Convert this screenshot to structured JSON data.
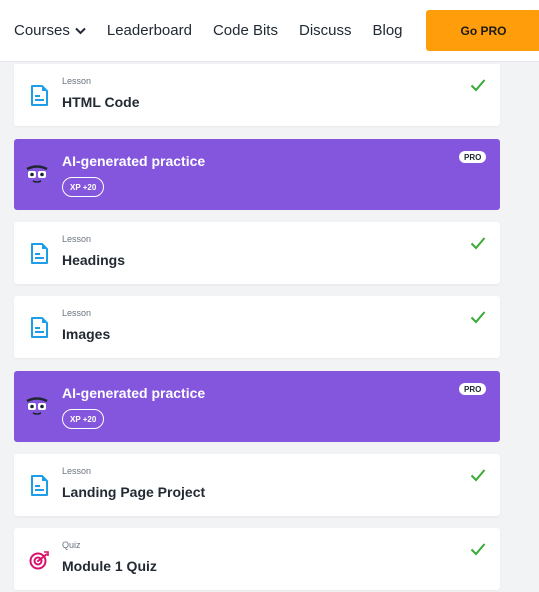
{
  "nav": {
    "courses": "Courses",
    "leaderboard": "Leaderboard",
    "code_bits": "Code Bits",
    "discuss": "Discuss",
    "blog": "Blog",
    "go_pro": "Go PRO"
  },
  "colors": {
    "accent_orange": "#ff9d0a",
    "practice_purple": "#8456dd",
    "lesson_icon_blue": "#1f9ee8",
    "quiz_icon_pink": "#d8126b",
    "check_green": "#3aaa35"
  },
  "items": {
    "html_code": {
      "kind": "Lesson",
      "title": "HTML Code",
      "icon": "document-icon",
      "status": "completed"
    },
    "practice_1": {
      "title": "AI-generated practice",
      "xp": "XP +20",
      "badge": "PRO",
      "icon": "mascot-icon"
    },
    "headings": {
      "kind": "Lesson",
      "title": "Headings",
      "icon": "document-icon",
      "status": "completed"
    },
    "images": {
      "kind": "Lesson",
      "title": "Images",
      "icon": "document-icon",
      "status": "completed"
    },
    "practice_2": {
      "title": "AI-generated practice",
      "xp": "XP +20",
      "badge": "PRO",
      "icon": "mascot-icon"
    },
    "landing": {
      "kind": "Lesson",
      "title": "Landing Page Project",
      "icon": "document-icon",
      "status": "completed"
    },
    "quiz": {
      "kind": "Quiz",
      "title": "Module 1 Quiz",
      "icon": "target-icon",
      "status": "completed"
    }
  }
}
